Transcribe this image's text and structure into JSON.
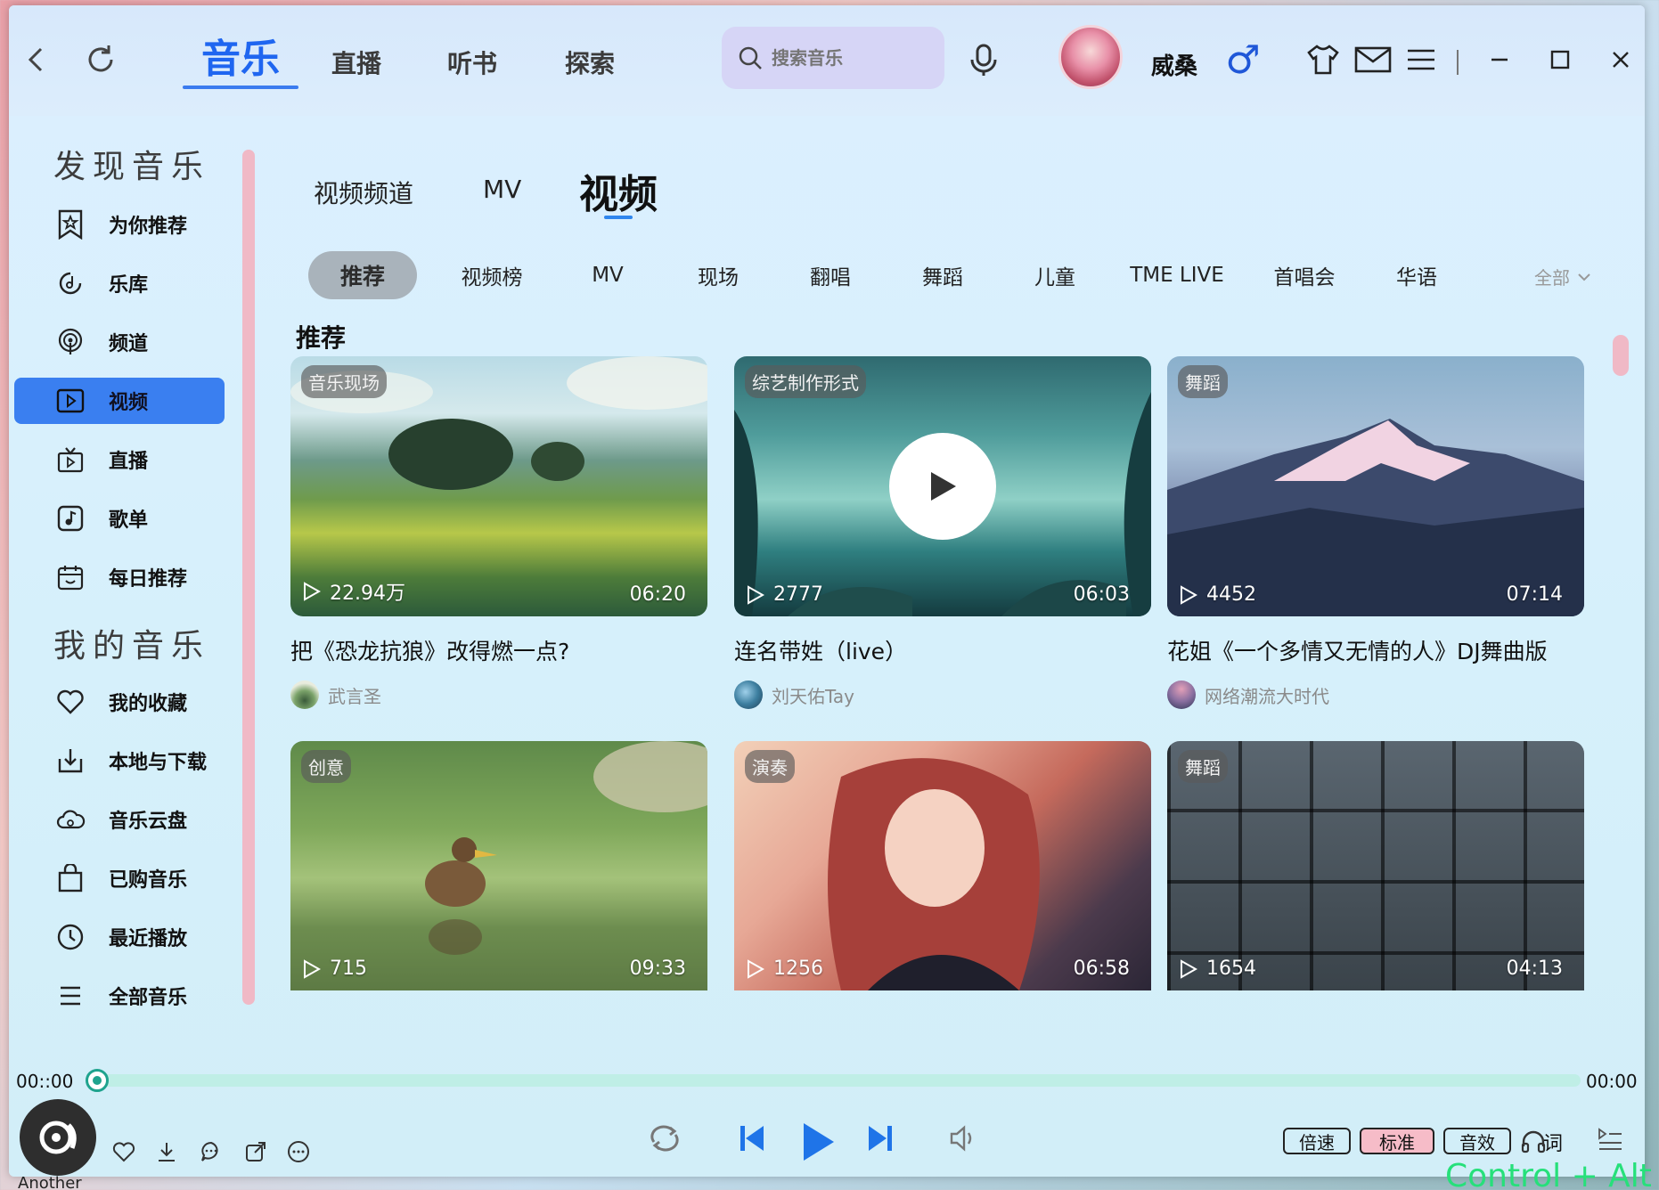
{
  "window": {
    "nav": {
      "back": "back",
      "refresh": "refresh"
    },
    "main_tabs": [
      "音乐",
      "直播",
      "听书",
      "探索"
    ],
    "search": {
      "placeholder": "搜索音乐"
    },
    "user": {
      "name": "威桑",
      "gender_symbol": "♂"
    }
  },
  "sidebar": {
    "section1": "发现音乐",
    "items1": [
      "为你推荐",
      "乐库",
      "频道",
      "视频",
      "直播",
      "歌单",
      "每日推荐"
    ],
    "section2": "我的音乐",
    "items2": [
      "我的收藏",
      "本地与下载",
      "音乐云盘",
      "已购音乐",
      "最近播放",
      "全部音乐"
    ],
    "active": "视频"
  },
  "content": {
    "sub_tabs": [
      "视频频道",
      "MV",
      "视频"
    ],
    "categories": [
      "推荐",
      "视频榜",
      "MV",
      "现场",
      "翻唱",
      "舞蹈",
      "儿童",
      "TME LIVE",
      "首唱会",
      "华语"
    ],
    "all_label": "全部",
    "section_title": "推荐",
    "cards": [
      {
        "tag": "音乐现场",
        "plays": "22.94万",
        "duration": "06:20",
        "title": "把《恐龙抗狼》改得燃一点?",
        "author": "武言圣"
      },
      {
        "tag": "综艺制作形式",
        "plays": "2777",
        "duration": "06:03",
        "title": "连名带姓（live）",
        "author": "刘天佑Tay"
      },
      {
        "tag": "舞蹈",
        "plays": "4452",
        "duration": "07:14",
        "title": "花姐《一个多情又无情的人》DJ舞曲版",
        "author": "网络潮流大时代"
      },
      {
        "tag": "创意",
        "plays": "715",
        "duration": "09:33"
      },
      {
        "tag": "演奏",
        "plays": "1256",
        "duration": "06:58"
      },
      {
        "tag": "舞蹈",
        "plays": "1654",
        "duration": "04:13"
      }
    ]
  },
  "player": {
    "current_time": "00::00",
    "total_time": "00:00",
    "progress": 0,
    "speed_label": "倍速",
    "quality_label": "标准",
    "effect_label": "音效",
    "lyric_label": "词"
  },
  "background_text": {
    "bottom_left": "Another",
    "overlay": "Control + Alt"
  },
  "colors": {
    "accent": "#1f66f0",
    "active_item": "#3a7ff0",
    "scroll": "#f0b9c6",
    "progress": "#bfeee6",
    "knob": "#1fa38e"
  }
}
